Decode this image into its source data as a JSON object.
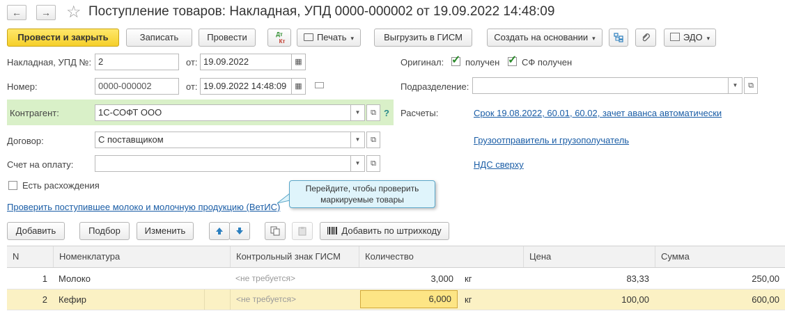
{
  "window": {
    "title": "Поступление товаров: Накладная, УПД 0000-000002 от 19.09.2022 14:48:09",
    "back_glyph": "←",
    "forward_glyph": "→",
    "favorite_glyph": "☆"
  },
  "toolbar": {
    "post_close": "Провести и закрыть",
    "save": "Записать",
    "post": "Провести",
    "dt_kt_top": "Дт",
    "dt_kt_bottom": "Кт",
    "print": "Печать",
    "export_gism": "Выгрузить в ГИСМ",
    "create_based": "Создать на основании",
    "edo": "ЭДО",
    "caret": "▾"
  },
  "form": {
    "invoice_label": "Накладная, УПД №:",
    "invoice_value": "2",
    "from_label": "от:",
    "invoice_date": "19.09.2022",
    "number_label": "Номер:",
    "number_value": "0000-000002",
    "number_datetime": "19.09.2022 14:48:09",
    "contractor_label": "Контрагент:",
    "contractor_value": "1С-СОФТ ООО",
    "help_glyph": "?",
    "contract_label": "Договор:",
    "contract_value": "С поставщиком",
    "invoice_pay_label": "Счет на оплату:",
    "invoice_pay_value": "",
    "discrepancy_label": "Есть расхождения",
    "original_label": "Оригинал:",
    "received_label": "получен",
    "sf_received_label": "СФ получен",
    "department_label": "Подразделение:",
    "department_value": "",
    "settlements_label": "Расчеты:",
    "settlements_link": "Срок 19.08.2022, 60.01, 60.02, зачет аванса автоматически",
    "shipper_link": "Грузоотправитель и грузополучатель",
    "vat_link": "НДС сверху",
    "vetis_link": "Проверить поступившее молоко и молочную продукцию (ВетИС)",
    "tooltip_line1": "Перейдите, чтобы проверить",
    "tooltip_line2": "маркируемые товары"
  },
  "table_toolbar": {
    "add": "Добавить",
    "select": "Подбор",
    "edit": "Изменить",
    "add_barcode": "Добавить по штрихкоду"
  },
  "table": {
    "columns": [
      "N",
      "Номенклатура",
      "Контрольный знак ГИСМ",
      "Количество",
      "Цена",
      "Сумма"
    ],
    "rows": [
      {
        "n": "1",
        "item": "Молоко",
        "gism": "<не требуется>",
        "qty": "3,000",
        "unit": "кг",
        "price": "83,33",
        "sum": "250,00"
      },
      {
        "n": "2",
        "item": "Кефир",
        "gism": "<не требуется>",
        "qty": "6,000",
        "unit": "кг",
        "price": "100,00",
        "sum": "600,00"
      }
    ]
  },
  "colors": {
    "primary_button": "#f5cf2a",
    "contractor_highlight": "#d9f0c8",
    "link": "#1a5da6",
    "selected_row": "#fbf1c4",
    "tooltip_bg": "#dff4fb"
  }
}
